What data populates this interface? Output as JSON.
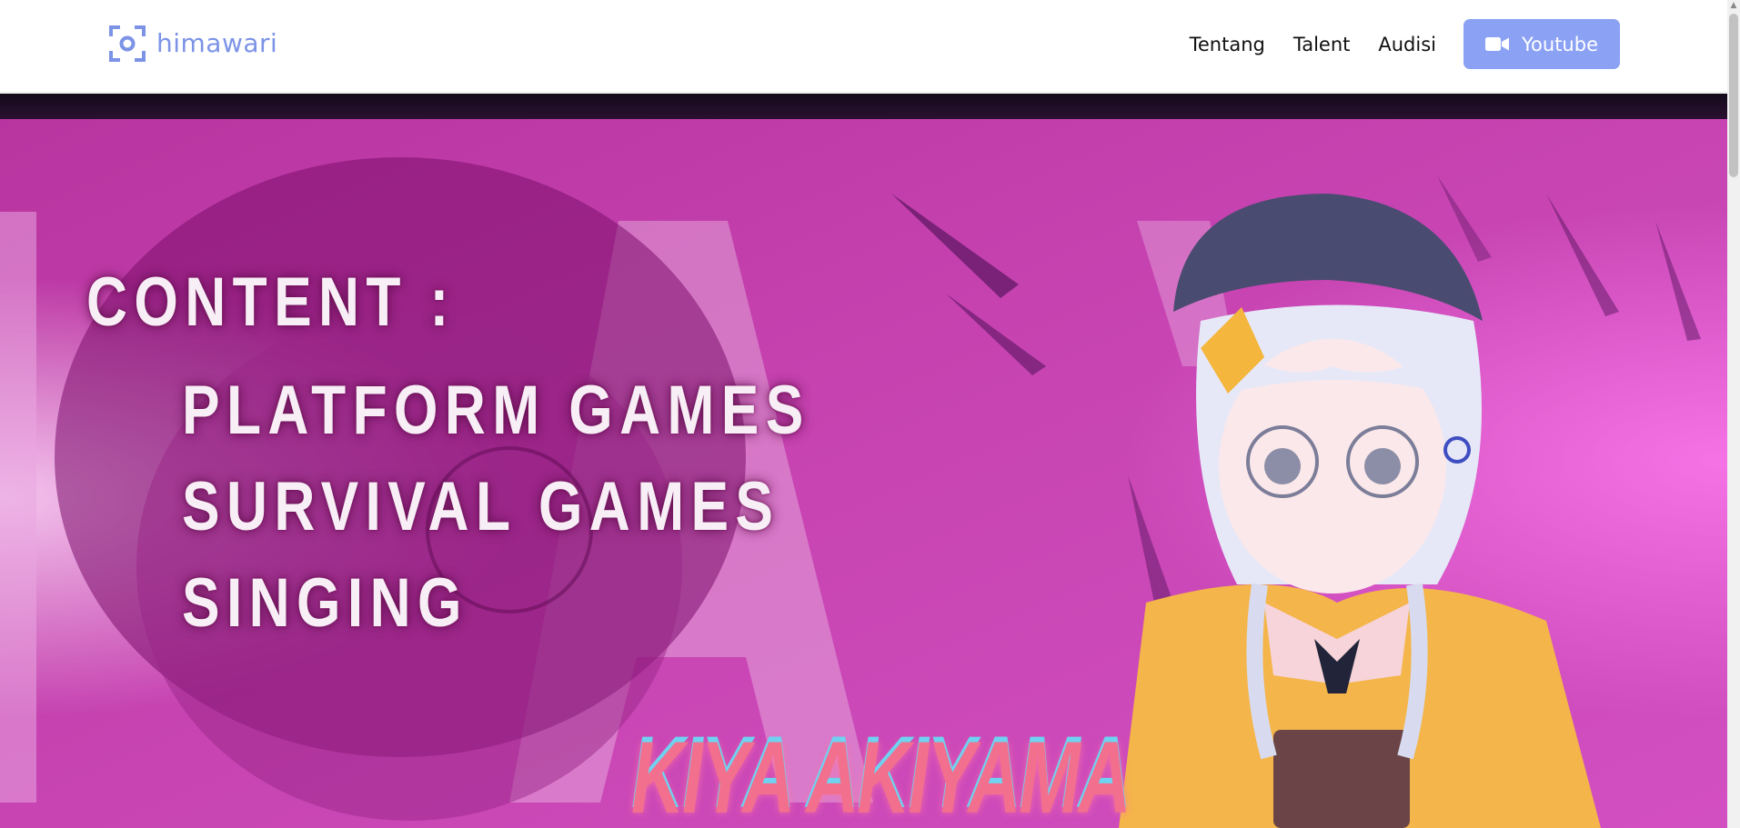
{
  "header": {
    "logo_text": "himawari",
    "logo_icon": "focus-camera-icon",
    "nav": [
      {
        "label": "Tentang"
      },
      {
        "label": "Talent"
      },
      {
        "label": "Audisi"
      }
    ],
    "youtube_button": {
      "label": "Youtube",
      "icon": "video-camera-icon"
    }
  },
  "hero": {
    "heading": "CONTENT :",
    "items": [
      "PLATFORM GAMES",
      "SURVIVAL GAMES",
      "SINGING"
    ],
    "talent_name": "KIYA AKIYAMA"
  },
  "colors": {
    "brand": "#7c93e6",
    "button_bg": "#8ba1f4",
    "hero_bg": "#c53fae"
  }
}
